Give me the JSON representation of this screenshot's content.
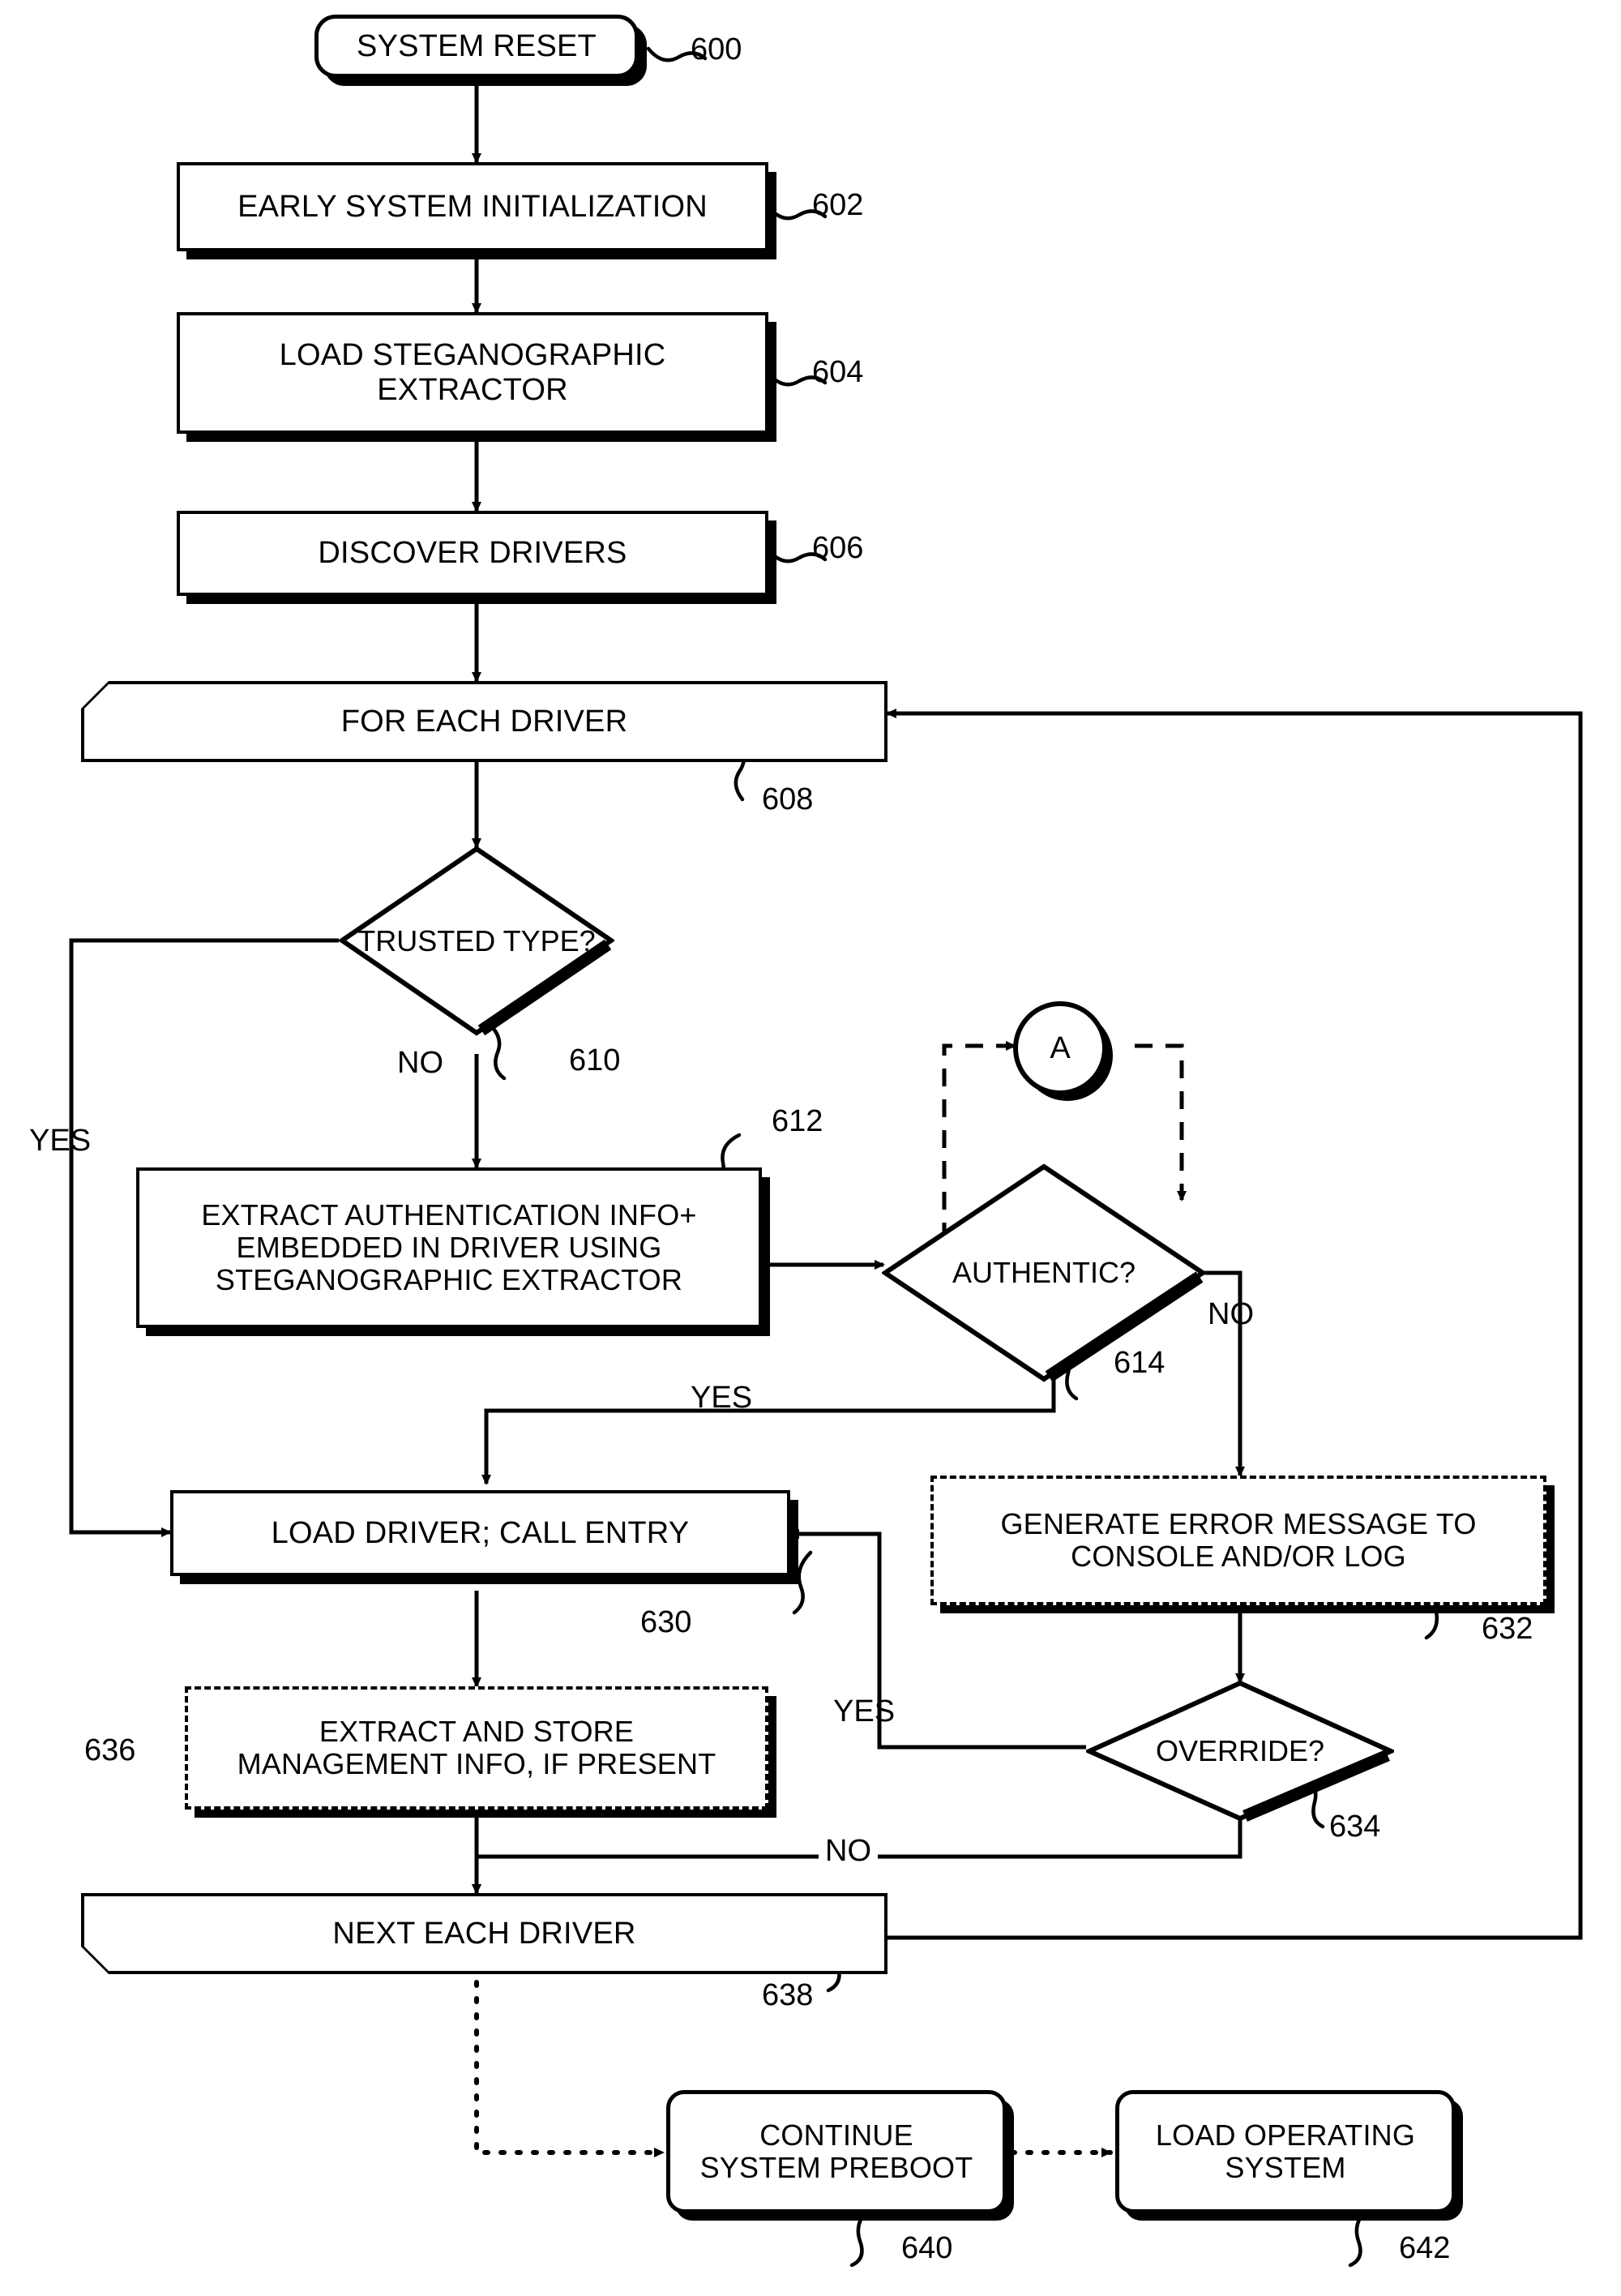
{
  "figure": {
    "kind": "patent-flowchart",
    "ink": "#000000",
    "paper": "#ffffff"
  },
  "nodes": {
    "system_reset": {
      "label": "SYSTEM RESET",
      "ref": "600"
    },
    "early_init": {
      "label": "EARLY SYSTEM INITIALIZATION",
      "ref": "602"
    },
    "load_extractor": {
      "label": "LOAD STEGANOGRAPHIC\nEXTRACTOR",
      "ref": "604"
    },
    "discover_drivers": {
      "label": "DISCOVER DRIVERS",
      "ref": "606"
    },
    "for_each_driver": {
      "label": "FOR EACH DRIVER",
      "ref": "608"
    },
    "trusted_type": {
      "label": "TRUSTED\nTYPE?",
      "ref": "610"
    },
    "extract_auth": {
      "label": "EXTRACT AUTHENTICATION INFO+\nEMBEDDED IN DRIVER USING\nSTEGANOGRAPHIC EXTRACTOR",
      "ref": "612"
    },
    "authentic": {
      "label": "AUTHENTIC?",
      "ref": "614"
    },
    "connector_a": {
      "label": "A"
    },
    "load_driver": {
      "label": "LOAD DRIVER; CALL ENTRY",
      "ref": "630"
    },
    "generate_error": {
      "label": "GENERATE ERROR MESSAGE TO\nCONSOLE AND/OR LOG",
      "ref": "632"
    },
    "override": {
      "label": "OVERRIDE?",
      "ref": "634"
    },
    "extract_mgmt": {
      "label": "EXTRACT AND STORE\nMANAGEMENT INFO, IF PRESENT",
      "ref": "636"
    },
    "next_each_driver": {
      "label": "NEXT EACH DRIVER",
      "ref": "638"
    },
    "continue_preboot": {
      "label": "CONTINUE\nSYSTEM PREBOOT",
      "ref": "640"
    },
    "load_os": {
      "label": "LOAD OPERATING\nSYSTEM",
      "ref": "642"
    }
  },
  "edge_labels": {
    "trusted_no": "NO",
    "trusted_yes": "YES",
    "authentic_no": "NO",
    "authentic_yes": "YES",
    "override_yes": "YES",
    "override_no": "NO"
  }
}
